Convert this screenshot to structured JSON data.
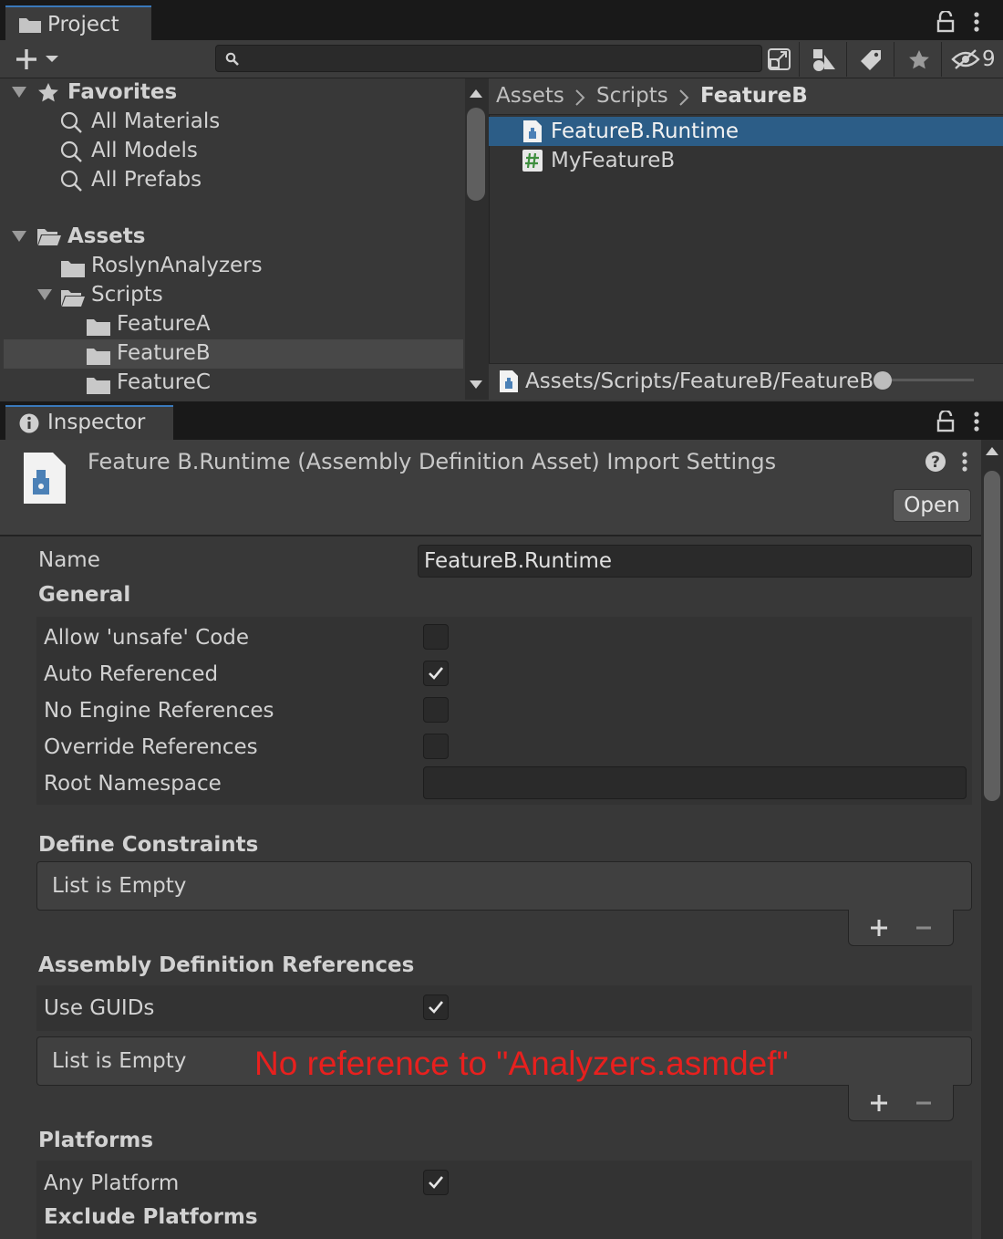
{
  "project": {
    "tab_label": "Project",
    "hidden_count": "9",
    "favorites": {
      "label": "Favorites",
      "items": [
        "All Materials",
        "All Models",
        "All Prefabs"
      ]
    },
    "assets": {
      "label": "Assets",
      "items": [
        "RoslynAnalyzers",
        "Scripts"
      ],
      "scripts_children": [
        "FeatureA",
        "FeatureB",
        "FeatureC"
      ]
    },
    "breadcrumb": [
      "Assets",
      "Scripts",
      "FeatureB"
    ],
    "files": [
      "FeatureB.Runtime",
      "MyFeatureB"
    ],
    "status_path": "Assets/Scripts/FeatureB/FeatureB"
  },
  "inspector": {
    "tab_label": "Inspector",
    "title": "Feature B.Runtime (Assembly Definition Asset) Import Settings",
    "open_label": "Open",
    "name_label": "Name",
    "name_value": "FeatureB.Runtime",
    "general": {
      "label": "General",
      "allow_unsafe": "Allow 'unsafe' Code",
      "auto_referenced": "Auto Referenced",
      "no_engine_refs": "No Engine References",
      "override_refs": "Override References",
      "root_namespace": "Root Namespace"
    },
    "define_constraints": {
      "label": "Define Constraints",
      "empty": "List is Empty"
    },
    "asmdef_refs": {
      "label": "Assembly Definition References",
      "use_guids": "Use GUIDs",
      "empty": "List is Empty",
      "annotation": "No reference to \"Analyzers.asmdef\""
    },
    "platforms": {
      "label": "Platforms",
      "any_platform": "Any Platform",
      "exclude": "Exclude Platforms"
    }
  },
  "icons": {
    "folder": "folder-icon",
    "search": "search-icon",
    "lock": "lock-icon",
    "menu": "kebab-menu-icon",
    "asmdef": "assembly-definition-icon",
    "script": "csharp-script-icon"
  },
  "colors": {
    "selection": "#2c5d87",
    "accent_tab": "#3a79bb",
    "annotation": "#e8201e"
  }
}
